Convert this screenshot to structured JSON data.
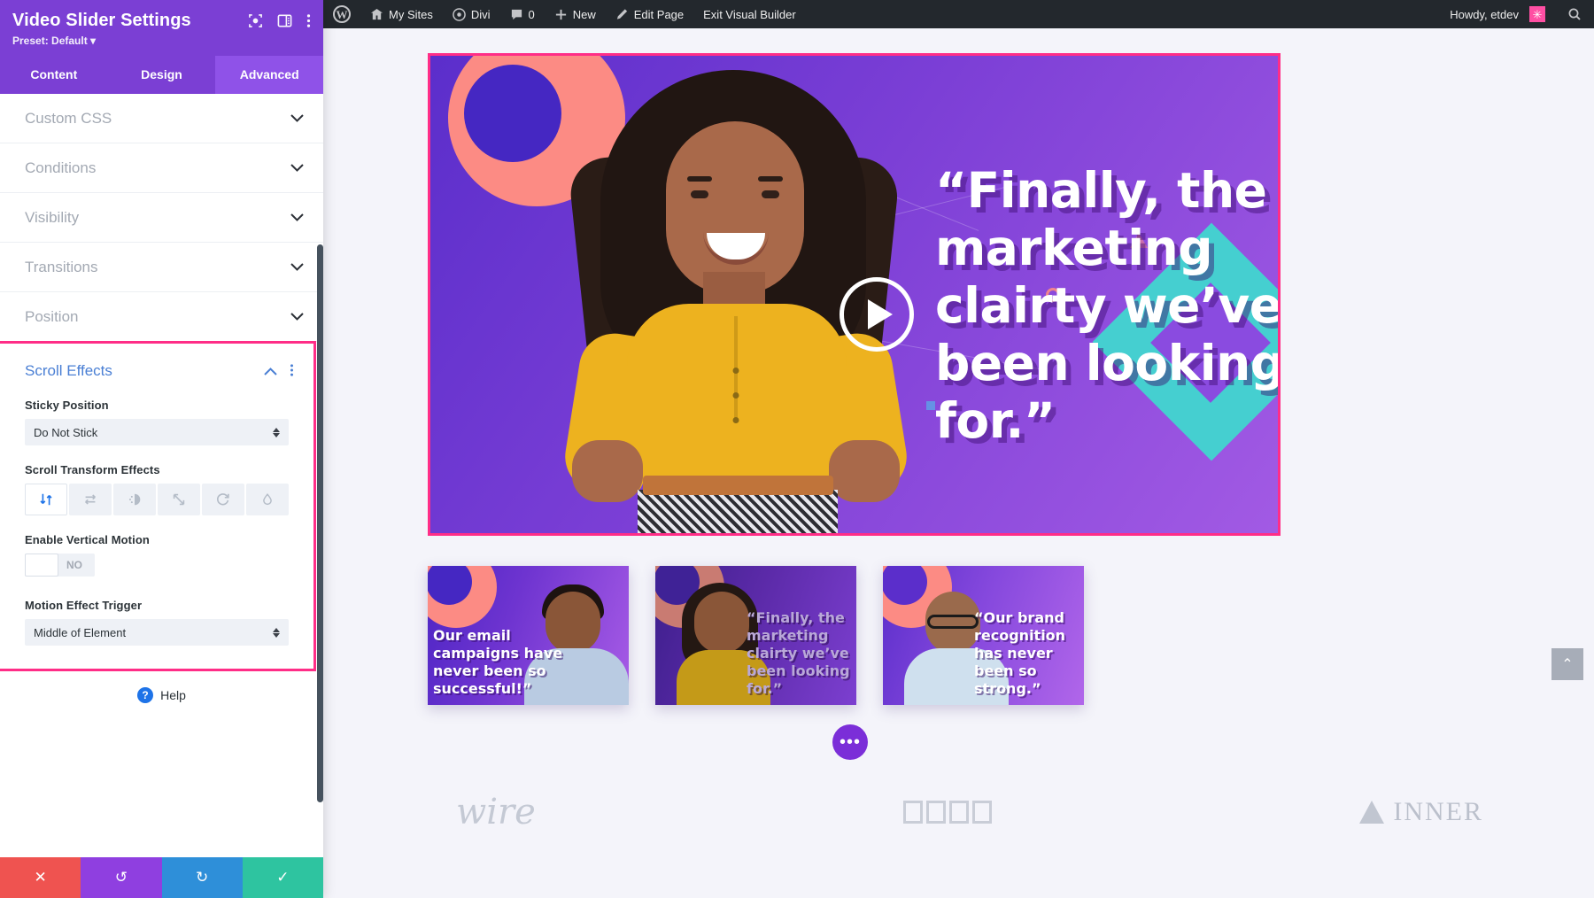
{
  "adminbar": {
    "logo_icon": "wordpress-logo-icon",
    "items": [
      {
        "icon": "sites-icon",
        "label": "My Sites"
      },
      {
        "icon": "divi-icon",
        "label": "Divi"
      },
      {
        "icon": "comment-icon",
        "label": "0"
      },
      {
        "icon": "plus-icon",
        "label": "New"
      },
      {
        "icon": "pencil-icon",
        "label": "Edit Page"
      },
      {
        "icon": "",
        "label": "Exit Visual Builder"
      }
    ],
    "howdy": "Howdy, etdev",
    "avatar_icon": "avatar-icon",
    "search_icon": "search-icon"
  },
  "panel": {
    "title": "Video Slider Settings",
    "preset": "Preset: Default",
    "head_icons": [
      "target-icon",
      "layout-icon",
      "kebab-menu-icon"
    ],
    "tabs": [
      {
        "label": "Content",
        "active": false
      },
      {
        "label": "Design",
        "active": false
      },
      {
        "label": "Advanced",
        "active": true
      }
    ],
    "accordions": [
      {
        "label": "Custom CSS"
      },
      {
        "label": "Conditions"
      },
      {
        "label": "Visibility"
      },
      {
        "label": "Transitions"
      },
      {
        "label": "Position"
      }
    ],
    "scroll_effects": {
      "title": "Scroll Effects",
      "collapse_icon": "chevron-up-icon",
      "menu_icon": "kebab-menu-icon",
      "highlight_color": "#ff2d87",
      "sticky_position": {
        "label": "Sticky Position",
        "value": "Do Not Stick"
      },
      "transform_effects": {
        "label": "Scroll Transform Effects",
        "options": [
          {
            "icon": "vertical-motion-icon",
            "active": true
          },
          {
            "icon": "horizontal-motion-icon",
            "active": false
          },
          {
            "icon": "fade-in-out-icon",
            "active": false
          },
          {
            "icon": "scaling-icon",
            "active": false
          },
          {
            "icon": "rotating-icon",
            "active": false
          },
          {
            "icon": "blur-icon",
            "active": false
          }
        ]
      },
      "vertical_motion": {
        "label": "Enable Vertical Motion",
        "value": "NO"
      },
      "motion_trigger": {
        "label": "Motion Effect Trigger",
        "value": "Middle of Element"
      }
    },
    "help": "Help",
    "footer": [
      {
        "icon": "close-icon",
        "name": "cancel-button"
      },
      {
        "icon": "undo-icon",
        "name": "undo-button"
      },
      {
        "icon": "redo-icon",
        "name": "redo-button"
      },
      {
        "icon": "check-icon",
        "name": "save-button"
      }
    ]
  },
  "canvas": {
    "hero_quote": "“Finally, the marketing clairty we’ve been looking for.”",
    "play_icon": "play-icon",
    "thumbnails": [
      {
        "quote": "Our email campaigns have never been so successful!”"
      },
      {
        "quote": "“Finally, the marketing clairty we’ve been looking for.”"
      },
      {
        "quote": "“Our brand recognition has never been so strong.”"
      }
    ],
    "dots_button": "module-settings-icon",
    "logos": [
      "wire",
      "boxes",
      "INNER"
    ],
    "scroll_top_icon": "chevron-up-icon"
  }
}
